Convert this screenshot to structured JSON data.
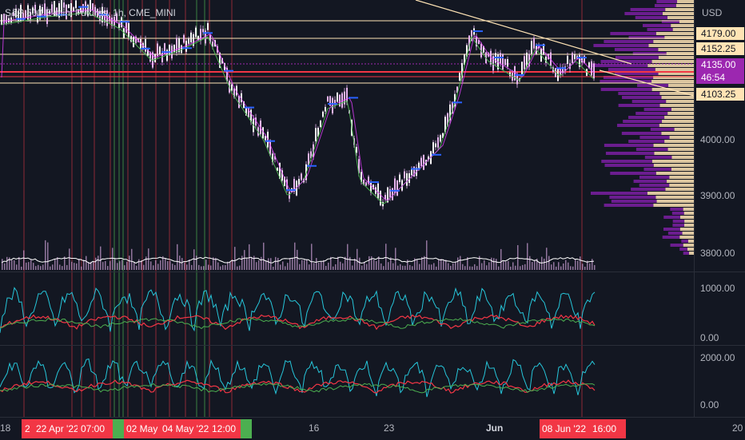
{
  "header": {
    "title": "S&P 500 E-mini Futures, 1h, CME_MINI",
    "currency": "USD"
  },
  "price_axis": {
    "labels": [
      "4000.00",
      "3900.00",
      "3800.00"
    ],
    "tags": {
      "level_4179": "4179.00",
      "level_4152": "4152.25",
      "last_price": "4135.00",
      "countdown": "46:54",
      "level_4103": "4103.25"
    }
  },
  "pane2_axis": {
    "labels": [
      "1000.00",
      "0.00"
    ]
  },
  "pane3_axis": {
    "labels": [
      "2000.00",
      "0.00"
    ]
  },
  "time_axis": {
    "labels": [
      "18",
      "16",
      "23",
      "Jun",
      "20"
    ],
    "badges": [
      "2",
      "22 Apr '22",
      "07:00",
      "02 May '22",
      "04 May '22",
      "12:00",
      "08 Jun '22",
      "16:00"
    ]
  },
  "colors": {
    "background": "#131722",
    "level_line": "#ffe4b5",
    "red_line": "#f23645",
    "green_line": "#4caf50",
    "purple": "#9c27b0",
    "cream": "#ffe4b5",
    "cyan": "#26c6da",
    "candle": "#e8b4f0"
  }
}
